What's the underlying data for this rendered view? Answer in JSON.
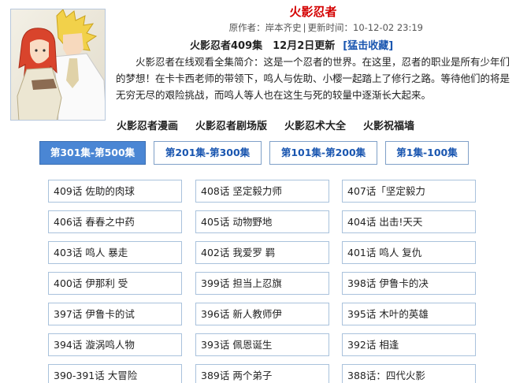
{
  "page": {
    "title": "火影忍者",
    "meta": {
      "author_label": "原作者：",
      "author": "岸本齐史",
      "updated_label": "更新时间：",
      "updated": "10-12-02 23:19"
    },
    "update_line": {
      "text": "火影忍者409集　12月2日更新",
      "favorite": "[猛击收藏]"
    },
    "intro": "火影忍者在线观看全集简介：这是一个忍者的世界。在这里，忍者的职业是所有少年们的梦想！在卡卡西老师的带领下，鸣人与佐助、小樱一起踏上了修行之路。等待他们的将是无穷无尽的艰险挑战，而鸣人等人也在这生与死的较量中逐渐长大起来。",
    "links": [
      "火影忍者漫画",
      "火影忍者剧场版",
      "火影忍术大全",
      "火影祝福墙"
    ]
  },
  "tabs": [
    {
      "label": "第301集-第500集",
      "active": true
    },
    {
      "label": "第201集-第300集",
      "active": false
    },
    {
      "label": "第101集-第200集",
      "active": false
    },
    {
      "label": "第1集-100集",
      "active": false
    }
  ],
  "episodes": [
    "409话 佐助的肉球",
    "408话 坚定毅力师",
    "407话「坚定毅力",
    "406话 春春之中药",
    "405话 动物野地",
    "404话 出击!天天",
    "403话 鸣人 暴走",
    "402话 我爱罗 羁",
    "401话 鸣人 复仇",
    "400话 伊那利 受",
    "399话 担当上忍旗",
    "398话 伊鲁卡的决",
    "397话 伊鲁卡的试",
    "396话 新人教师伊",
    "395话 木叶的英雄",
    "394话 漩涡鸣人物",
    "393话 佩恩诞生",
    "392话 相逢",
    "390-391话 大冒险",
    "389话 两个弟子",
    "388话：四代火影"
  ],
  "colors": {
    "title": "#d40000",
    "tab_active_bg": "#4a86d4",
    "link_blue": "#1a56b0",
    "cell_border": "#a9c2dc"
  }
}
